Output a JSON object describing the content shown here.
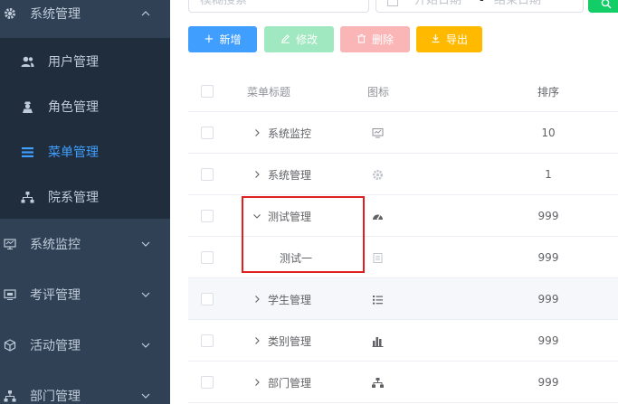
{
  "sidebar": {
    "groups": [
      {
        "label": "系统管理",
        "icon": "gear-icon",
        "expanded": true
      },
      {
        "label": "系统监控",
        "icon": "monitor-icon",
        "expanded": false
      },
      {
        "label": "考评管理",
        "icon": "screen-icon",
        "expanded": false
      },
      {
        "label": "活动管理",
        "icon": "cube-icon",
        "expanded": false
      },
      {
        "label": "部门管理",
        "icon": "tree-icon",
        "expanded": false
      }
    ],
    "subitems": [
      {
        "label": "用户管理",
        "icon": "user-icon",
        "active": false
      },
      {
        "label": "角色管理",
        "icon": "role-icon",
        "active": false
      },
      {
        "label": "菜单管理",
        "icon": "list-icon",
        "active": true
      },
      {
        "label": "院系管理",
        "icon": "tree-icon",
        "active": false
      }
    ]
  },
  "search": {
    "placeholder": "模糊搜索",
    "date_start_placeholder": "开始日期",
    "date_separator": "-",
    "date_end_placeholder": "结束日期"
  },
  "toolbar": {
    "add_label": "新增",
    "edit_label": "修改",
    "delete_label": "删除",
    "export_label": "导出"
  },
  "table": {
    "columns": {
      "title": "菜单标题",
      "icon": "图标",
      "sort": "排序"
    },
    "rows": [
      {
        "title": "系统监控",
        "icon": "monitor-icon",
        "sort": "10",
        "level": 0,
        "expanded": false
      },
      {
        "title": "系统管理",
        "icon": "gear-icon",
        "sort": "1",
        "level": 0,
        "expanded": false
      },
      {
        "title": "测试管理",
        "icon": "dashboard-icon",
        "sort": "999",
        "level": 0,
        "expanded": true
      },
      {
        "title": "测试一",
        "icon": "doc-icon",
        "sort": "999",
        "level": 1,
        "expanded": false
      },
      {
        "title": "学生管理",
        "icon": "list-icon",
        "sort": "999",
        "level": 0,
        "expanded": false
      },
      {
        "title": "类别管理",
        "icon": "bar-chart-icon",
        "sort": "999",
        "level": 0,
        "expanded": false
      },
      {
        "title": "部门管理",
        "icon": "tree-icon",
        "sort": "999",
        "level": 0,
        "expanded": false
      }
    ]
  },
  "colors": {
    "sidebar_bg": "#304156",
    "submenu_bg": "#1f2d3d",
    "active": "#409eff",
    "highlight": "#e02020"
  }
}
